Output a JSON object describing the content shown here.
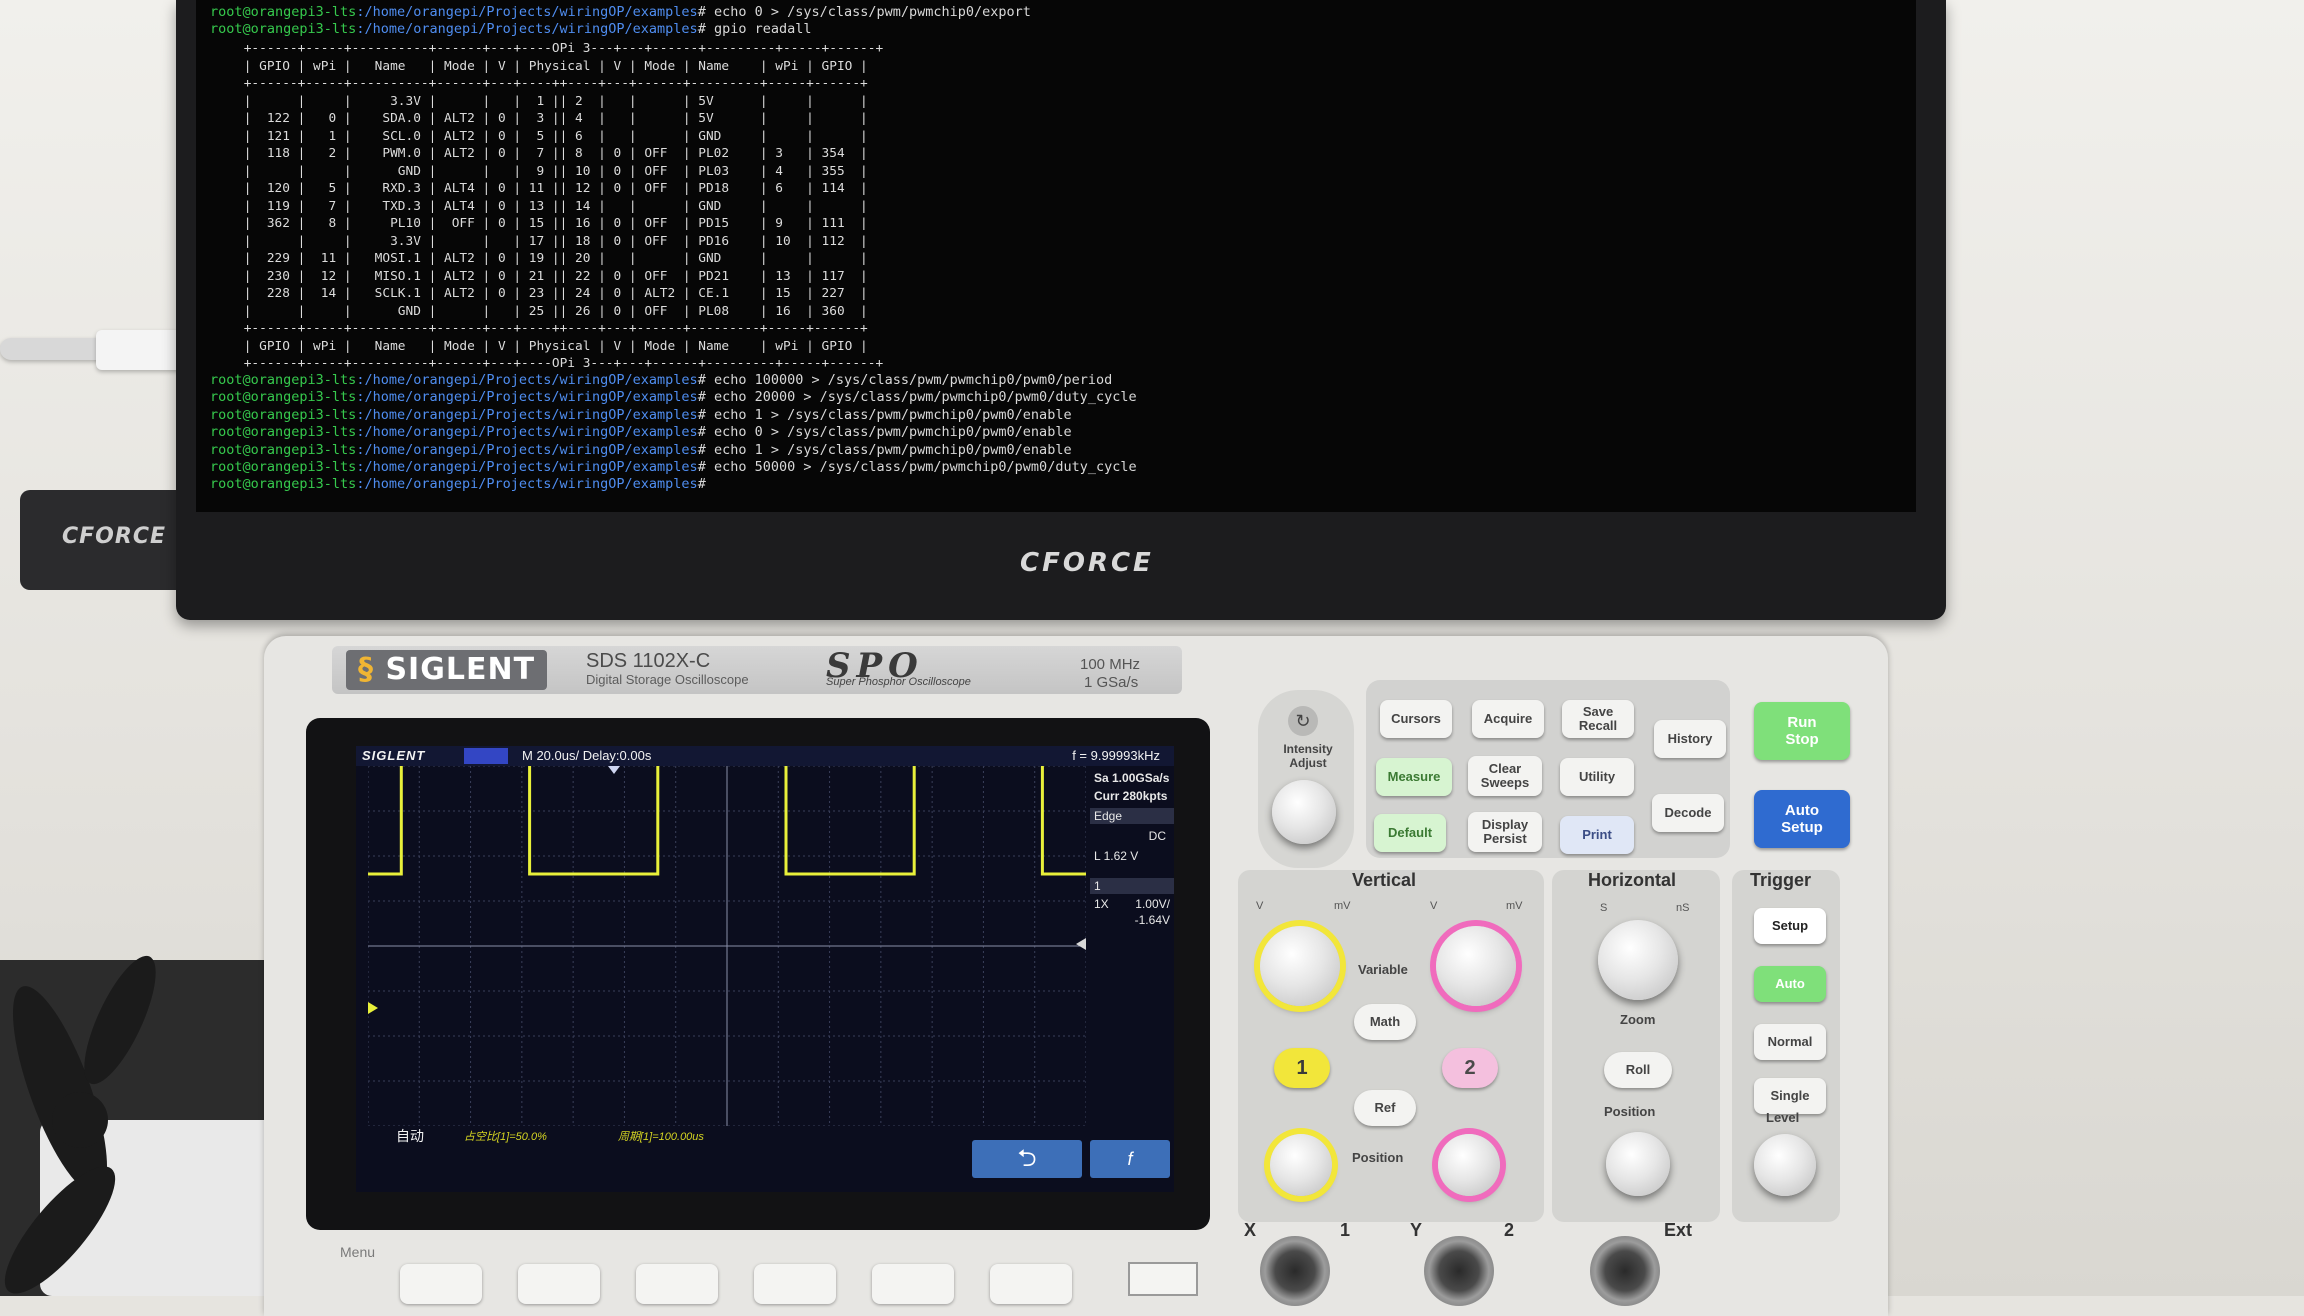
{
  "terminal": {
    "prompt_user": "root@orangepi3-lts",
    "prompt_path": ":/home/orangepi/Projects/wiringOP/examples",
    "header_commands": [
      "echo 0 > /sys/class/pwm/pwmchip0/export",
      "gpio readall"
    ],
    "readall_rows": [
      " +------+-----+----------+------+---+----OPi 3---+---+------+---------+-----+------+",
      " | GPIO | wPi |   Name   | Mode | V | Physical | V | Mode | Name    | wPi | GPIO |",
      " +------+-----+----------+------+---+----++----+---+------+---------+-----+------+",
      " |      |     |     3.3V |      |   |  1 || 2  |   |      | 5V      |     |      |",
      " |  122 |   0 |    SDA.0 | ALT2 | 0 |  3 || 4  |   |      | 5V      |     |      |",
      " |  121 |   1 |    SCL.0 | ALT2 | 0 |  5 || 6  |   |      | GND     |     |      |",
      " |  118 |   2 |    PWM.0 | ALT2 | 0 |  7 || 8  | 0 | OFF  | PL02    | 3   | 354  |",
      " |      |     |      GND |      |   |  9 || 10 | 0 | OFF  | PL03    | 4   | 355  |",
      " |  120 |   5 |    RXD.3 | ALT4 | 0 | 11 || 12 | 0 | OFF  | PD18    | 6   | 114  |",
      " |  119 |   7 |    TXD.3 | ALT4 | 0 | 13 || 14 |   |      | GND     |     |      |",
      " |  362 |   8 |     PL10 |  OFF | 0 | 15 || 16 | 0 | OFF  | PD15    | 9   | 111  |",
      " |      |     |     3.3V |      |   | 17 || 18 | 0 | OFF  | PD16    | 10  | 112  |",
      " |  229 |  11 |   MOSI.1 | ALT2 | 0 | 19 || 20 |   |      | GND     |     |      |",
      " |  230 |  12 |   MISO.1 | ALT2 | 0 | 21 || 22 | 0 | OFF  | PD21    | 13  | 117  |",
      " |  228 |  14 |   SCLK.1 | ALT2 | 0 | 23 || 24 | 0 | ALT2 | CE.1    | 15  | 227  |",
      " |      |     |      GND |      |   | 25 || 26 | 0 | OFF  | PL08    | 16  | 360  |",
      " +------+-----+----------+------+---+----++----+---+------+---------+-----+------+",
      " | GPIO | wPi |   Name   | Mode | V | Physical | V | Mode | Name    | wPi | GPIO |",
      " +------+-----+----------+------+---+----OPi 3---+---+------+---------+-----+------+"
    ],
    "tail_commands": [
      "echo 100000 > /sys/class/pwm/pwmchip0/pwm0/period",
      "echo 20000 > /sys/class/pwm/pwmchip0/pwm0/duty_cycle",
      "echo 1 > /sys/class/pwm/pwmchip0/pwm0/enable",
      "echo 0 > /sys/class/pwm/pwmchip0/pwm0/enable",
      "echo 1 > /sys/class/pwm/pwmchip0/pwm0/enable",
      "echo 50000 > /sys/class/pwm/pwmchip0/pwm0/duty_cycle",
      ""
    ]
  },
  "monitor": {
    "logo": "CFORCE"
  },
  "usb_stick": {
    "logo": "CFORCE"
  },
  "scope": {
    "brand": "SIGLENT",
    "model": "SDS 1102X-C",
    "subtitle": "Digital Storage Oscilloscope",
    "spo": "SPO",
    "spo_sub": "Super Phosphor Oscilloscope",
    "spec_bw": "100 MHz",
    "spec_rate": "1 GSa/s",
    "screen": {
      "brand": "SIGLENT",
      "timebase": "M 20.0us/  Delay:0.00s",
      "freq": "f = 9.99993kHz",
      "side": {
        "sample_rate": "Sa 1.00GSa/s",
        "curr": "Curr 280kpts",
        "trig_type": "Edge",
        "coupling": "DC",
        "level": "L    1.62 V",
        "ch_num": "1",
        "probe": "1X",
        "scale": "1.00V/",
        "offset": "-1.64V"
      },
      "bottom_mode": "自动",
      "bottom_duty": "占空比[1]=50.0%",
      "bottom_period": "周期[1]=100.00us",
      "back_icon": "⮌",
      "fn_icon": "f"
    },
    "menu_label": "Menu",
    "buttons": {
      "cursors": "Cursors",
      "acquire": "Acquire",
      "save_recall": "Save\nRecall",
      "history": "History",
      "measure": "Measure",
      "clear_sweeps": "Clear\nSweeps",
      "utility": "Utility",
      "decode": "Decode",
      "default": "Default",
      "display_persist": "Display\nPersist",
      "print": "Print",
      "run_stop": "Run\nStop",
      "auto_setup": "Auto\nSetup",
      "math": "Math",
      "ref": "Ref",
      "roll": "Roll",
      "setup": "Setup",
      "auto": "Auto",
      "normal": "Normal",
      "single": "Single"
    },
    "labels": {
      "intensity": "Intensity\nAdjust",
      "vertical": "Vertical",
      "horizontal": "Horizontal",
      "trigger": "Trigger",
      "variable": "Variable",
      "position": "Position",
      "zoom": "Zoom",
      "level": "Level",
      "ch1": "1",
      "ch2": "2",
      "v_left": "V",
      "mv_left": "mV",
      "v_right": "V",
      "mv_right": "mV",
      "s_unit": "S",
      "ns_unit": "nS"
    },
    "inputs": {
      "x": "X",
      "x_num": "1",
      "y": "Y",
      "y_num": "2",
      "ext": "Ext"
    }
  },
  "chart_data": {
    "type": "line",
    "title": "",
    "xlabel": "",
    "ylabel": "",
    "x_units": "us",
    "timebase_us_per_div": 20,
    "y_units": "V",
    "volts_per_div": 1.0,
    "x": [
      0,
      13,
      13,
      63,
      63,
      113,
      113,
      163,
      163,
      213,
      213,
      263,
      263,
      280
    ],
    "y": [
      0,
      0,
      3.3,
      3.3,
      0,
      0,
      3.3,
      3.3,
      0,
      0,
      3.3,
      3.3,
      0,
      0
    ],
    "period_us": 100,
    "duty_percent": 50,
    "xlim": [
      0,
      280
    ],
    "ylim": [
      -4,
      4
    ],
    "color": "#e8f03a",
    "grid": true
  }
}
